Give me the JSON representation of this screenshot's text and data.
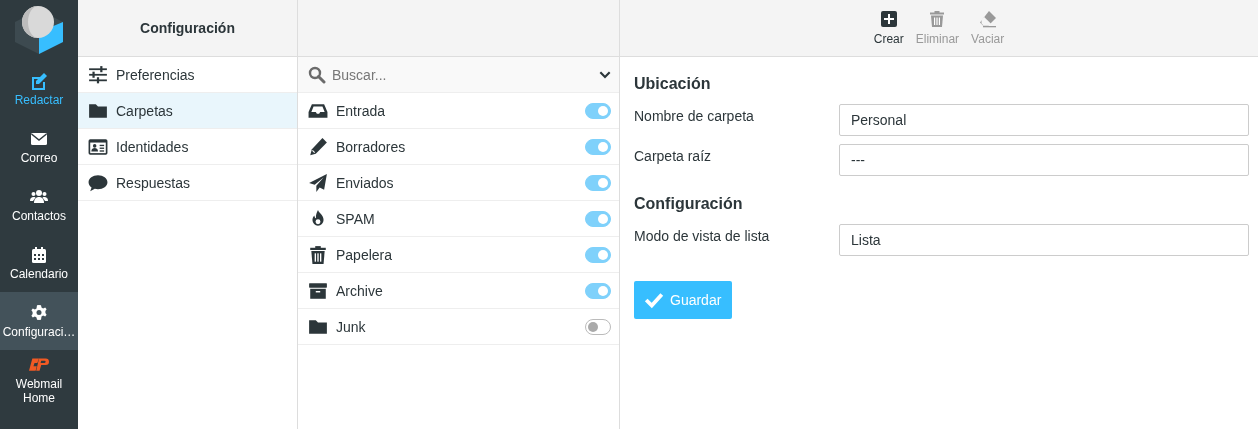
{
  "nav": {
    "items": [
      {
        "label": "Redactar",
        "kind": "compose",
        "selected": false
      },
      {
        "label": "Correo",
        "kind": "mail",
        "selected": false
      },
      {
        "label": "Contactos",
        "kind": "contacts",
        "selected": false
      },
      {
        "label": "Calendario",
        "kind": "calendar",
        "selected": false
      },
      {
        "label": "Configuraci…",
        "kind": "settings",
        "selected": true
      },
      {
        "label": "Webmail Home",
        "kind": "home",
        "selected": false
      }
    ]
  },
  "settings": {
    "title": "Configuración",
    "items": [
      {
        "label": "Preferencias",
        "kind": "sliders",
        "selected": false
      },
      {
        "label": "Carpetas",
        "kind": "folder",
        "selected": true
      },
      {
        "label": "Identidades",
        "kind": "idcard",
        "selected": false
      },
      {
        "label": "Respuestas",
        "kind": "comment",
        "selected": false
      }
    ]
  },
  "folders": {
    "search": {
      "placeholder": "Buscar..."
    },
    "items": [
      {
        "name": "Entrada",
        "kind": "inbox",
        "on": true
      },
      {
        "name": "Borradores",
        "kind": "pencil",
        "on": true
      },
      {
        "name": "Enviados",
        "kind": "plane",
        "on": true
      },
      {
        "name": "SPAM",
        "kind": "fire",
        "on": true
      },
      {
        "name": "Papelera",
        "kind": "trash",
        "on": true
      },
      {
        "name": "Archive",
        "kind": "archive",
        "on": true
      },
      {
        "name": "Junk",
        "kind": "folder",
        "on": false
      }
    ]
  },
  "toolbar": {
    "buttons": [
      {
        "label": "Crear",
        "kind": "plus",
        "disabled": false
      },
      {
        "label": "Eliminar",
        "kind": "trash",
        "disabled": true
      },
      {
        "label": "Vaciar",
        "kind": "eraser",
        "disabled": true
      }
    ]
  },
  "form": {
    "sections": [
      {
        "title": "Ubicación",
        "fields": [
          {
            "label": "Nombre de carpeta",
            "value": "Personal"
          },
          {
            "label": "Carpeta raíz",
            "value": "---"
          }
        ]
      },
      {
        "title": "Configuración",
        "fields": [
          {
            "label": "Modo de vista de lista",
            "value": "Lista"
          }
        ]
      }
    ],
    "save_button": {
      "label": "Guardar"
    }
  }
}
